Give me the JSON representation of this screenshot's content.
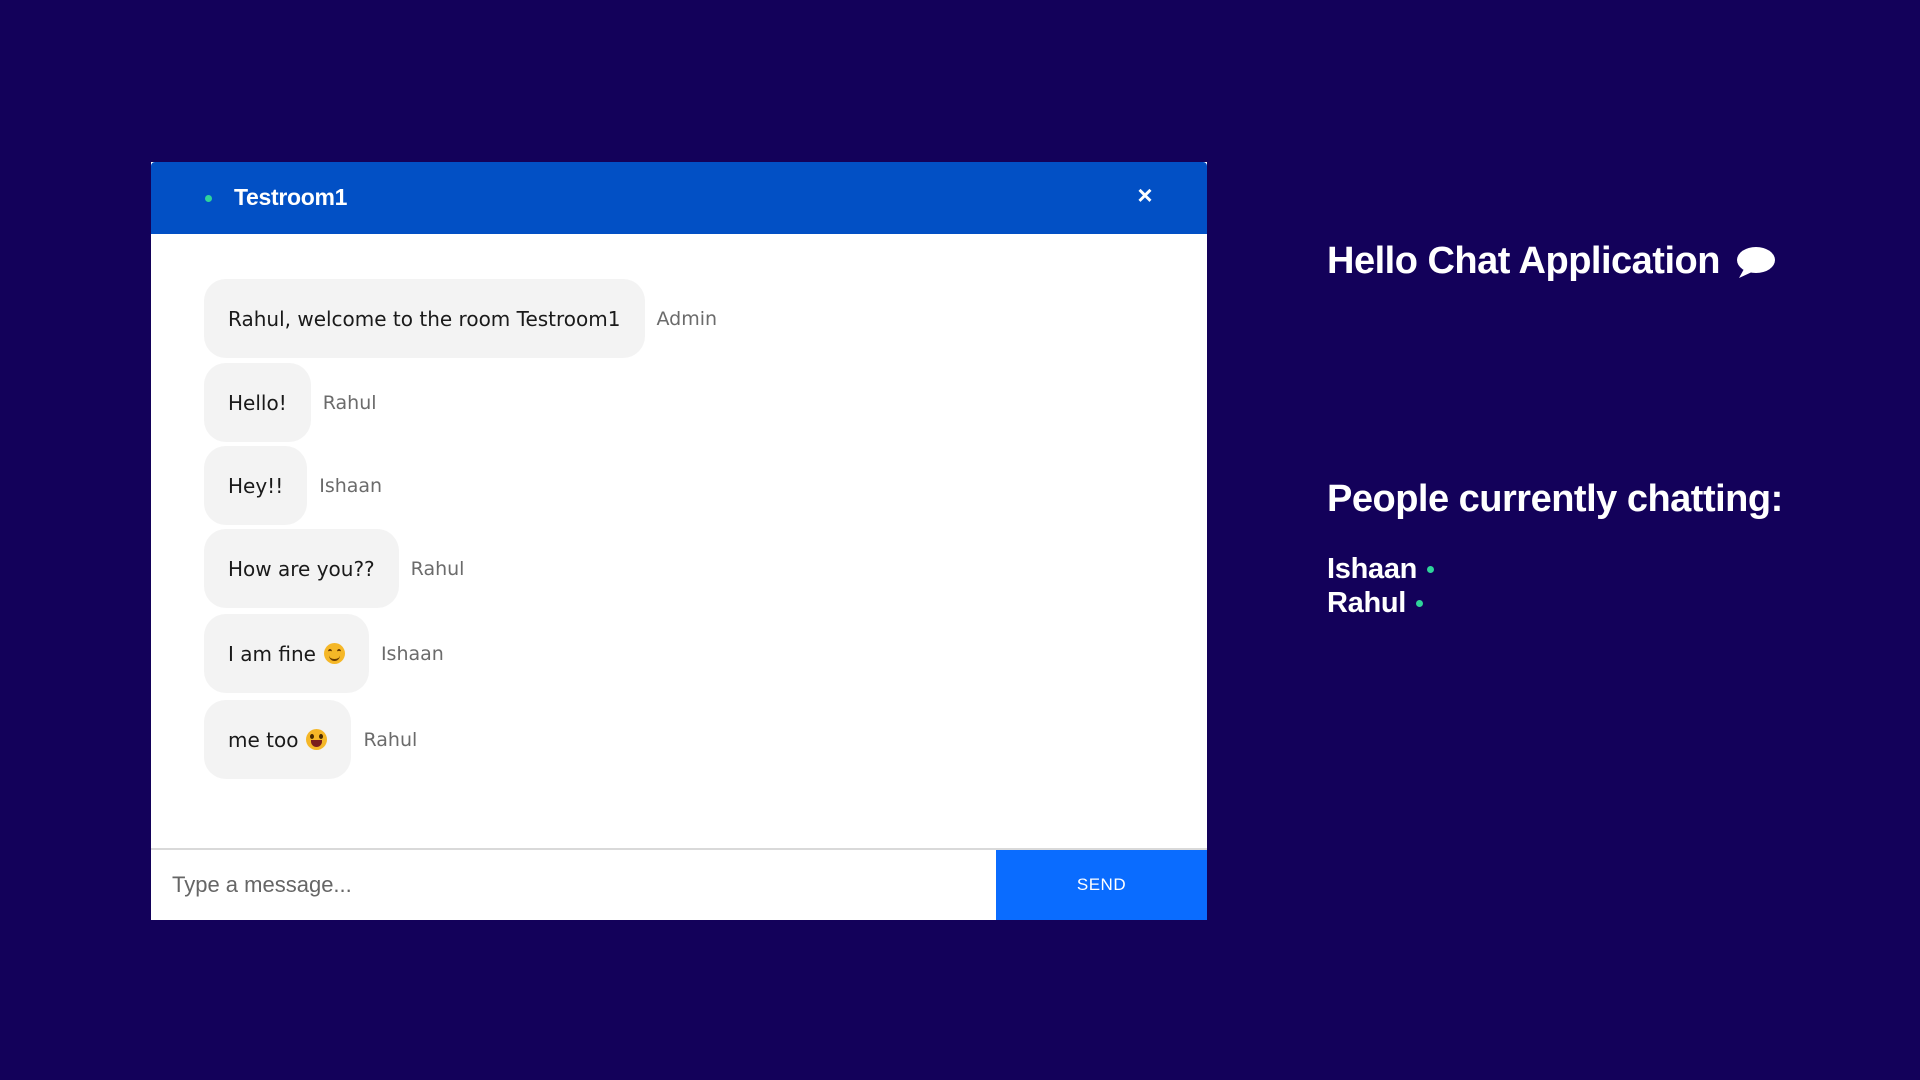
{
  "chat": {
    "room_name": "Testroom1",
    "close_label": "×",
    "messages": [
      {
        "text": "Rahul, welcome to the room Testroom1",
        "sender": "Admin",
        "emoji": ""
      },
      {
        "text": "Hello!",
        "sender": "Rahul",
        "emoji": ""
      },
      {
        "text": "Hey!!",
        "sender": "Ishaan",
        "emoji": ""
      },
      {
        "text": "How are you??",
        "sender": "Rahul",
        "emoji": ""
      },
      {
        "text": "I am fine",
        "sender": "Ishaan",
        "emoji": "smiling-face-icon"
      },
      {
        "text": "me too",
        "sender": "Rahul",
        "emoji": "tongue-face-icon"
      }
    ],
    "input": {
      "placeholder": "Type a message...",
      "value": ""
    },
    "send_label": "SEND"
  },
  "side": {
    "app_title": "Hello Chat Application",
    "app_icon": "speech-bubble-icon",
    "people_title": "People currently chatting:",
    "people": [
      "Ishaan",
      "Rahul"
    ]
  },
  "colors": {
    "background": "#13015a",
    "header": "#0250c5",
    "send_button": "#0a6cff",
    "online": "#2fd39a",
    "bubble": "#f3f3f3"
  }
}
